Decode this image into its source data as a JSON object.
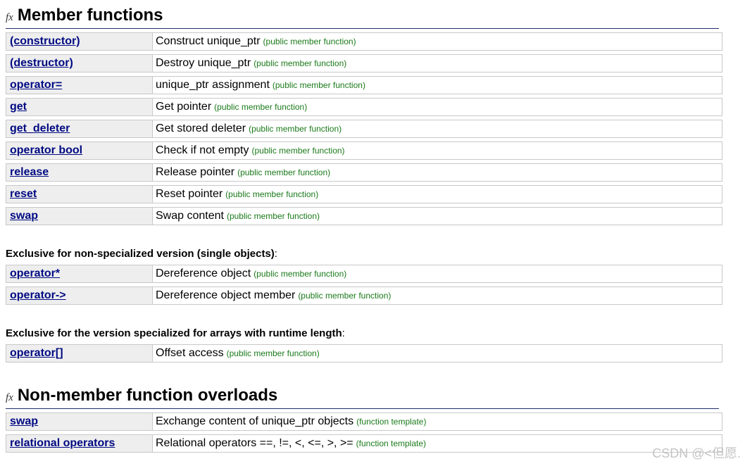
{
  "member_section": {
    "icon": "fx",
    "title": "Member functions",
    "rows": [
      {
        "name": "(constructor)",
        "desc": "Construct unique_ptr",
        "kind": "(public member function)"
      },
      {
        "name": "(destructor)",
        "desc": "Destroy unique_ptr",
        "kind": "(public member function)"
      },
      {
        "name": "operator=",
        "desc": "unique_ptr assignment",
        "kind": "(public member function)"
      },
      {
        "name": "get",
        "desc": "Get pointer",
        "kind": "(public member function)"
      },
      {
        "name": "get_deleter",
        "desc": "Get stored deleter",
        "kind": "(public member function)"
      },
      {
        "name": "operator bool",
        "desc": "Check if not empty",
        "kind": "(public member function)"
      },
      {
        "name": "release",
        "desc": "Release pointer",
        "kind": "(public member function)"
      },
      {
        "name": "reset",
        "desc": "Reset pointer",
        "kind": "(public member function)"
      },
      {
        "name": "swap",
        "desc": "Swap content",
        "kind": "(public member function)"
      }
    ]
  },
  "single_section": {
    "heading": "Exclusive for non-specialized version (single objects)",
    "colon": ":",
    "rows": [
      {
        "name": "operator*",
        "desc": "Dereference object",
        "kind": "(public member function)"
      },
      {
        "name": "operator->",
        "desc": "Dereference object member",
        "kind": "(public member function)"
      }
    ]
  },
  "array_section": {
    "heading": "Exclusive for the version specialized for arrays with runtime length",
    "colon": ":",
    "rows": [
      {
        "name": "operator[]",
        "desc": "Offset access",
        "kind": "(public member function)"
      }
    ]
  },
  "nonmember_section": {
    "icon": "fx",
    "title": "Non-member function overloads",
    "rows": [
      {
        "name": "swap",
        "desc": "Exchange content of unique_ptr objects",
        "kind": "(function template)"
      },
      {
        "name": "relational operators",
        "desc": "Relational operators ==, !=, <, <=, >, >=",
        "kind": "(function template)"
      }
    ]
  },
  "watermark": "CSDN @<但愿."
}
